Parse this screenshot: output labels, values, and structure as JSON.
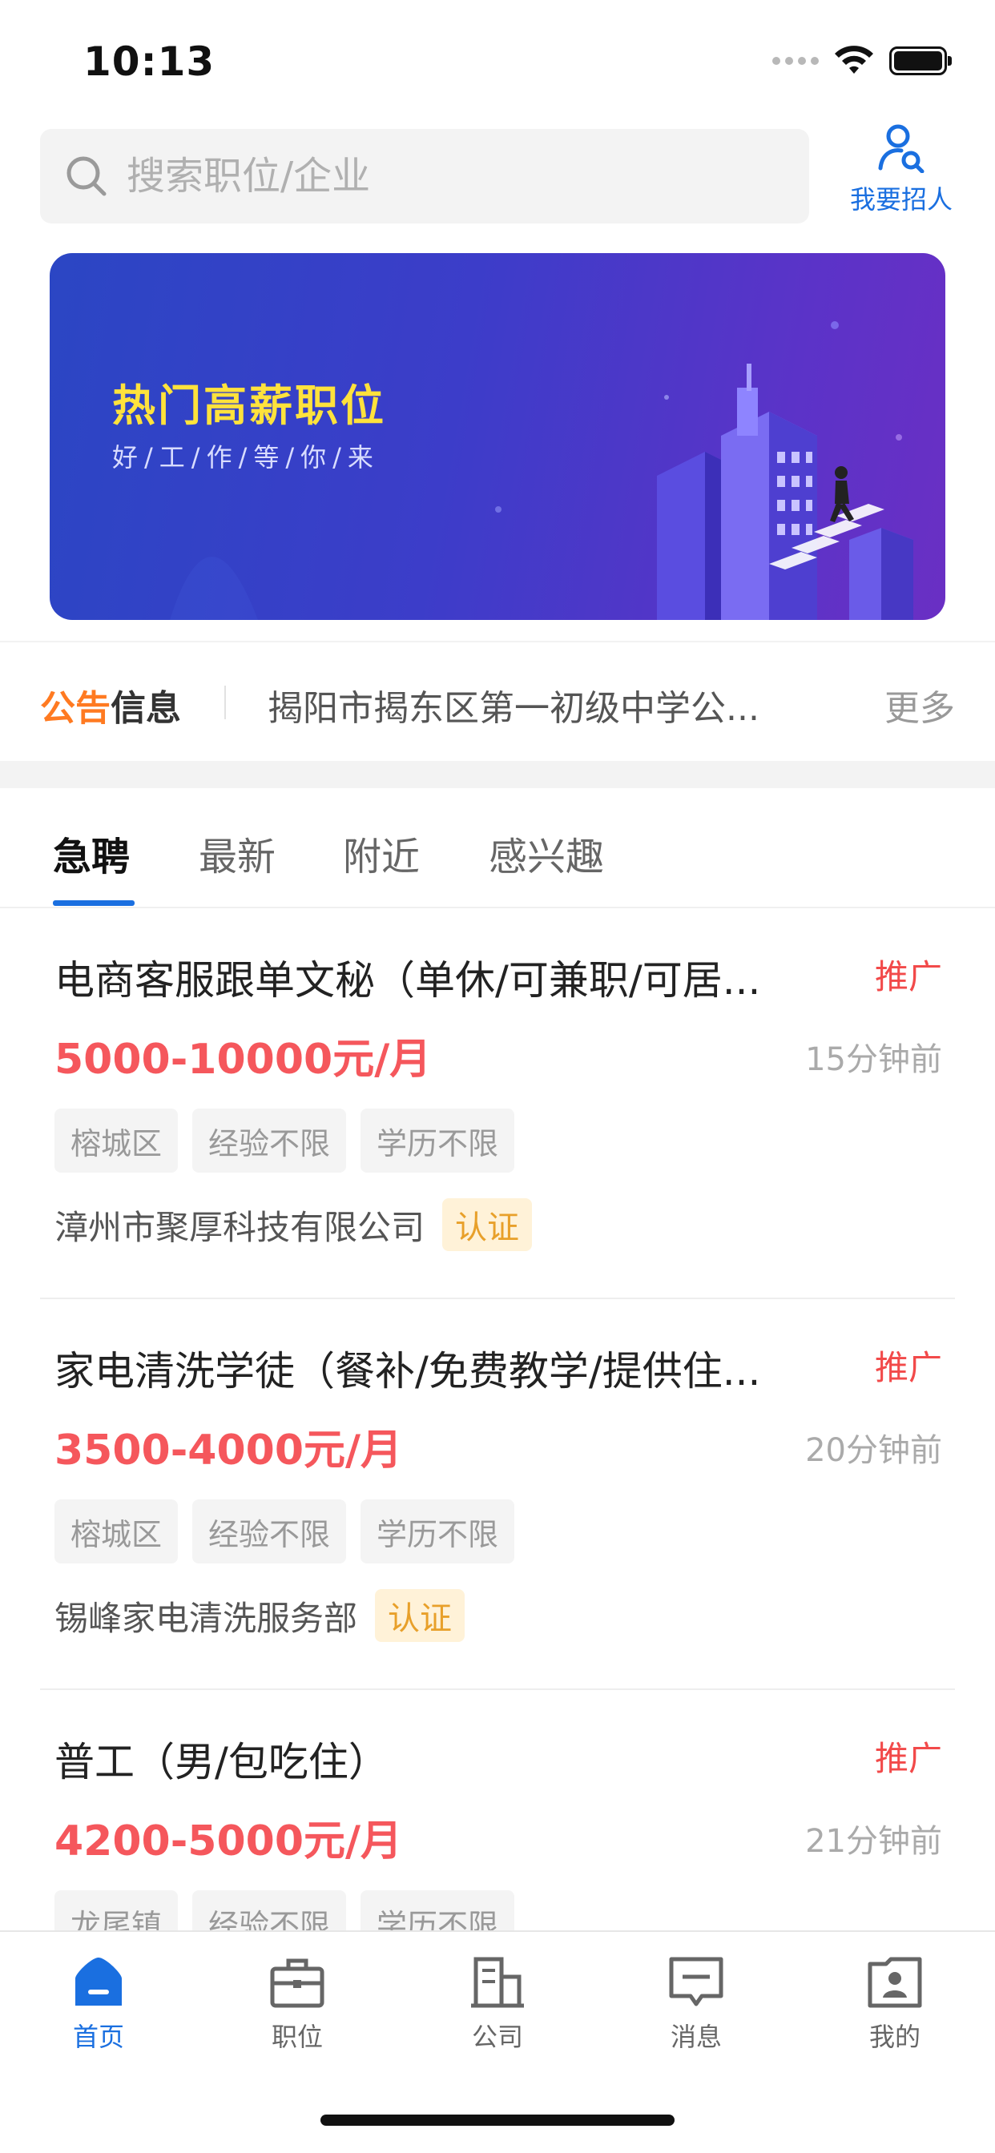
{
  "status_bar": {
    "time": "10:13"
  },
  "search": {
    "placeholder": "搜索职位/企业",
    "value": ""
  },
  "recruit": {
    "label": "我要招人"
  },
  "banner": {
    "title": "热门高薪职位",
    "subtitle": "好/工/作/等/你/来"
  },
  "notice": {
    "label_part1": "公告",
    "label_part2": "信息",
    "text": "揭阳市揭东区第一初级中学公...",
    "more": "更多"
  },
  "tabs": [
    {
      "label": "急聘",
      "active": true
    },
    {
      "label": "最新",
      "active": false
    },
    {
      "label": "附近",
      "active": false
    },
    {
      "label": "感兴趣",
      "active": false
    }
  ],
  "jobs": [
    {
      "title": "电商客服跟单文秘（单休/可兼职/可居...",
      "promo": "推广",
      "salary": "5000-10000元/月",
      "time": "15分钟前",
      "tags": [
        "榕城区",
        "经验不限",
        "学历不限"
      ],
      "company": "漳州市聚厚科技有限公司",
      "verified": "认证"
    },
    {
      "title": "家电清洗学徒（餐补/免费教学/提供住...",
      "promo": "推广",
      "salary": "3500-4000元/月",
      "time": "20分钟前",
      "tags": [
        "榕城区",
        "经验不限",
        "学历不限"
      ],
      "company": "锡峰家电清洗服务部",
      "verified": "认证"
    },
    {
      "title": "普工（男/包吃住）",
      "promo": "推广",
      "salary": "4200-5000元/月",
      "time": "21分钟前",
      "tags": [
        "龙尾镇",
        "经验不限",
        "学历不限"
      ],
      "company": "",
      "verified": ""
    }
  ],
  "nav": [
    {
      "label": "首页",
      "icon": "home-icon",
      "active": true
    },
    {
      "label": "职位",
      "icon": "briefcase-icon",
      "active": false
    },
    {
      "label": "公司",
      "icon": "building-icon",
      "active": false
    },
    {
      "label": "消息",
      "icon": "message-icon",
      "active": false
    },
    {
      "label": "我的",
      "icon": "profile-icon",
      "active": false
    }
  ],
  "colors": {
    "accent": "#1a6fe0",
    "salary": "#f5575c",
    "promo": "#f24a4a",
    "notice": "#ff7a21",
    "banner_title": "#ffe23c"
  }
}
